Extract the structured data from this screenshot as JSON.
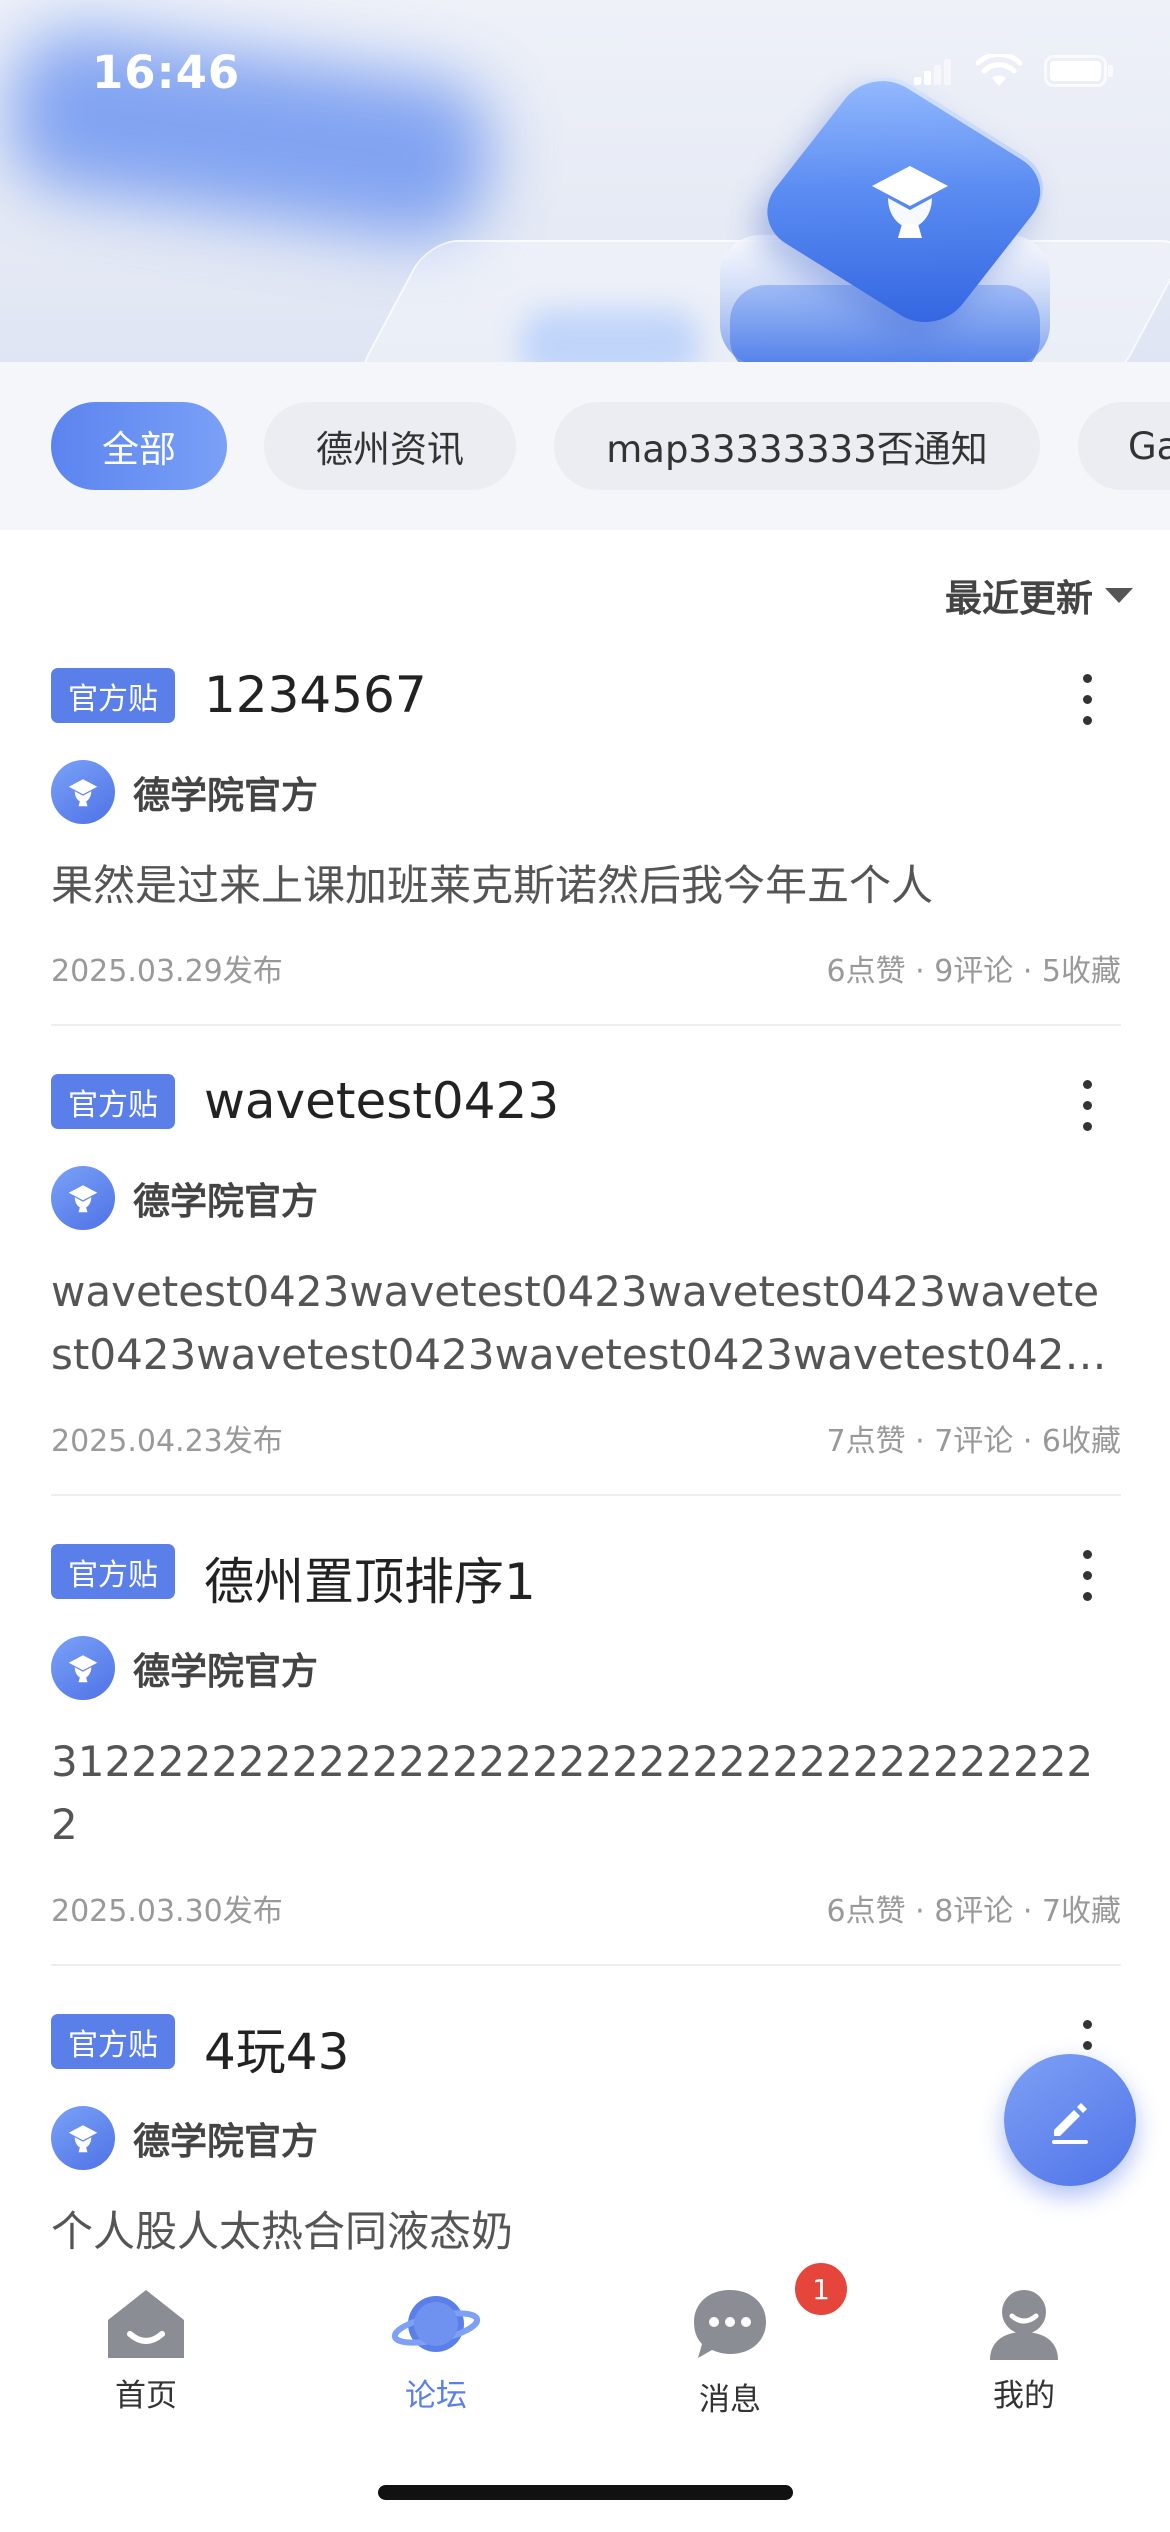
{
  "status_bar": {
    "time": "16:46"
  },
  "tabs": [
    {
      "label": "全部",
      "active": true
    },
    {
      "label": "德州资讯",
      "active": false
    },
    {
      "label": "map33333333否通知",
      "active": false
    },
    {
      "label": "Ga",
      "active": false
    }
  ],
  "sort": {
    "label": "最近更新"
  },
  "posts": [
    {
      "badge": "官方贴",
      "title": "1234567",
      "author": "德学院官方",
      "content": "果然是过来上课加班莱克斯诺然后我今年五个人",
      "date": "2025.03.29发布",
      "stats": "6点赞 · 9评论 · 5收藏"
    },
    {
      "badge": "官方贴",
      "title": "wavetest0423",
      "author": "德学院官方",
      "content": "wavetest0423wavetest0423wavetest0423wavetest0423wavetest0423wavetest0423wavetest042…",
      "date": "2025.04.23发布",
      "stats": "7点赞 · 7评论 · 6收藏"
    },
    {
      "badge": "官方贴",
      "title": "德州置顶排序1",
      "author": "德学院官方",
      "content": "3122222222222222222222222222222222222222",
      "date": "2025.03.30发布",
      "stats": "6点赞 · 8评论 · 7收藏"
    },
    {
      "badge": "官方贴",
      "title": "4玩43",
      "author": "德学院官方",
      "content": "个人股人太热合同液态奶"
    }
  ],
  "nav": {
    "items": [
      {
        "label": "首页",
        "icon": "home-icon",
        "active": false
      },
      {
        "label": "论坛",
        "icon": "planet-icon",
        "active": true
      },
      {
        "label": "消息",
        "icon": "chat-icon",
        "active": false,
        "badge": "1"
      },
      {
        "label": "我的",
        "icon": "user-icon",
        "active": false
      }
    ]
  },
  "colors": {
    "accent": "#5b7fe9",
    "badge_red": "#e5453a"
  }
}
